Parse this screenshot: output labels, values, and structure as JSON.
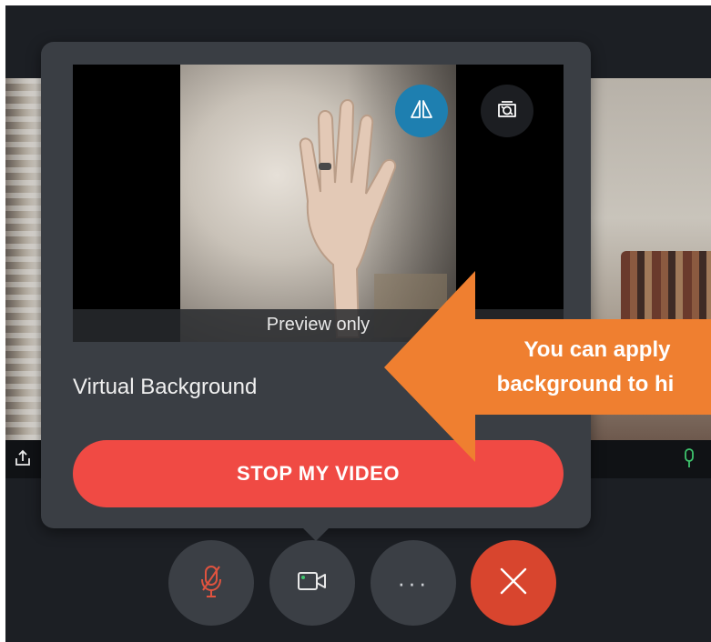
{
  "preview": {
    "caption": "Preview only",
    "flip_icon": "mirror-flip-icon",
    "switch_icon": "switch-camera-icon"
  },
  "settings": {
    "virtual_background_label": "Virtual Background"
  },
  "actions": {
    "stop_video_label": "STOP MY VIDEO"
  },
  "controls": {
    "mute_icon": "microphone-muted-icon",
    "video_icon": "video-camera-icon",
    "more_label": "···",
    "hangup_icon": "close-icon"
  },
  "annotation": {
    "line1": "You can apply",
    "line2": "background to hi"
  },
  "colors": {
    "popup_bg": "#3a3e44",
    "stop_button": "#f04a44",
    "flip_button": "#1e7fb0",
    "hangup_button": "#d8452e",
    "annotation": "#ef7f30",
    "mic_active": "#3ec46d"
  }
}
